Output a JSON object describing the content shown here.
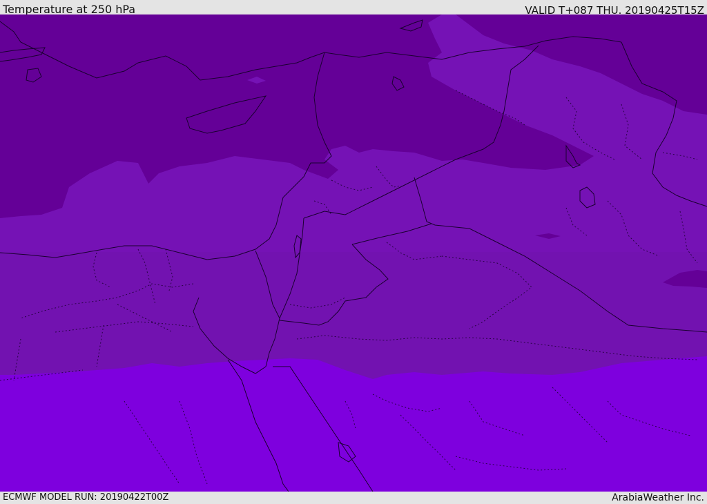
{
  "header": {
    "title": "Temperature at 250 hPa",
    "valid_time": "VALID T+087 THU. 20190425T15Z"
  },
  "footer": {
    "model_run": "ECMWF MODEL RUN: 20190422T00Z",
    "credit": "ArabiaWeather Inc."
  },
  "colors": {
    "coldest_band": "#640097",
    "cold_band": "#7512b5",
    "mid_band": "#7212b0",
    "warm_band": "#7e00de",
    "boundary_line": "#1a0030"
  },
  "map": {
    "field": "temperature",
    "level": "250 hPa",
    "region": "Eastern Mediterranean / Middle East"
  }
}
